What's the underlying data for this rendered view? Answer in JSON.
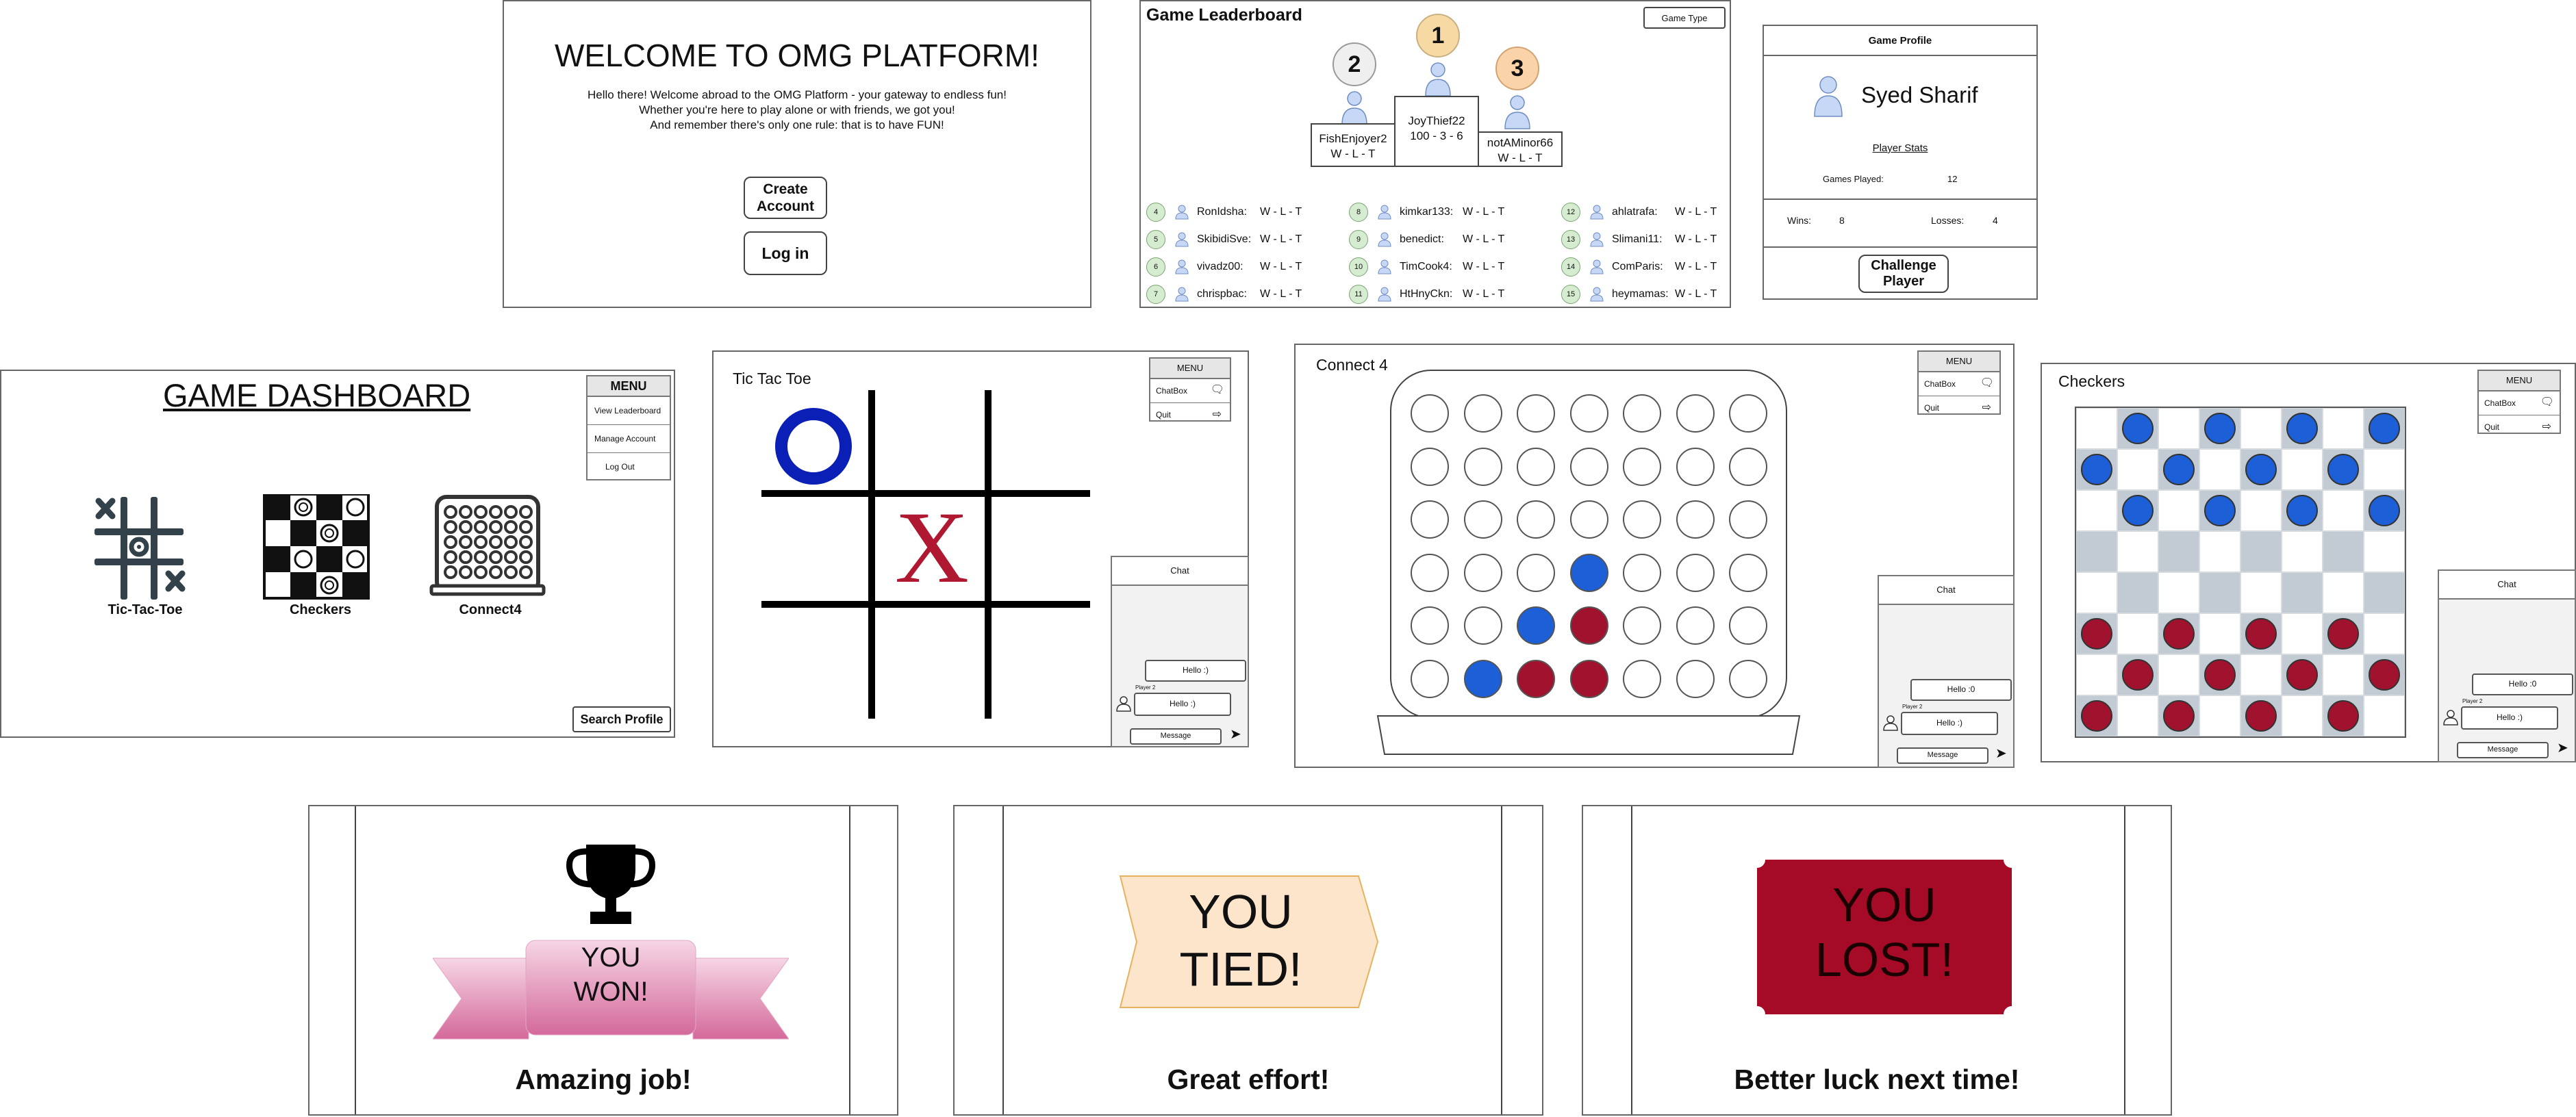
{
  "welcome": {
    "title": "WELCOME TO OMG PLATFORM!",
    "lines": [
      "Hello there! Welcome abroad to the OMG Platform - your gateway to endless fun!",
      "Whether you're here to play alone or with friends, we got you!",
      "And remember there's only one rule: that is to have FUN!"
    ],
    "create_account_line1": "Create",
    "create_account_line2": "Account",
    "login_label": "Log in"
  },
  "leaderboard": {
    "title": "Game Leaderboard",
    "game_type_label": "Game Type",
    "podium": [
      {
        "rank": "1",
        "name": "JoyThief22",
        "record": "100 - 3 - 6"
      },
      {
        "rank": "2",
        "name": "FishEnjoyer2",
        "record": "W - L - T"
      },
      {
        "rank": "3",
        "name": "notAMinor66",
        "record": "W - L - T"
      }
    ],
    "columns": [
      [
        {
          "rank": "4",
          "name": "RonIdsha:",
          "record": "W - L - T"
        },
        {
          "rank": "5",
          "name": "SkibidiSve:",
          "record": "W - L - T"
        },
        {
          "rank": "6",
          "name": "vivadz00:",
          "record": "W - L - T"
        },
        {
          "rank": "7",
          "name": "chrispbac:",
          "record": "W - L - T"
        }
      ],
      [
        {
          "rank": "8",
          "name": "kimkar133:",
          "record": "W - L - T"
        },
        {
          "rank": "9",
          "name": "benedict:",
          "record": "W - L - T"
        },
        {
          "rank": "10",
          "name": "TimCook4:",
          "record": "W - L - T"
        },
        {
          "rank": "11",
          "name": "HtHnyCkn:",
          "record": "W - L - T"
        }
      ],
      [
        {
          "rank": "12",
          "name": "ahlatrafa:",
          "record": "W - L - T"
        },
        {
          "rank": "13",
          "name": "Slimani11:",
          "record": "W - L - T"
        },
        {
          "rank": "14",
          "name": "ComParis:",
          "record": "W - L - T"
        },
        {
          "rank": "15",
          "name": "heymamas:",
          "record": "W - L - T"
        }
      ]
    ]
  },
  "profile": {
    "title": "Game Profile",
    "player_name": "Syed Sharif",
    "stats_label": "Player Stats",
    "games_played_label": "Games Played:",
    "games_played": "12",
    "wins_label": "Wins:",
    "wins": "8",
    "losses_label": "Losses:",
    "losses": "4",
    "challenge_line1": "Challenge",
    "challenge_line2": "Player"
  },
  "dashboard": {
    "title": "GAME DASHBOARD",
    "menu_title": "MENU",
    "menu_items": [
      "View Leaderboard",
      "Manage Account",
      "Log Out"
    ],
    "games": [
      "Tic-Tac-Toe",
      "Checkers",
      "Connect4"
    ],
    "search_profile_label": "Search Profile"
  },
  "game_menu": {
    "title": "MENU",
    "chatbox_label": "ChatBox",
    "quit_label": "Quit"
  },
  "chat": {
    "title": "Chat",
    "my_message": "Hello :)",
    "player2_label": "Player 2",
    "player2_message": "Hello :)",
    "input_placeholder": "Message"
  },
  "chat_alt": {
    "my_message": "Hello :0",
    "player2_message": "Hello :)"
  },
  "tictactoe": {
    "title": "Tic Tac Toe",
    "x_mark": "X"
  },
  "connect4": {
    "title": "Connect 4",
    "board": [
      [
        "",
        "",
        "",
        "",
        "",
        "",
        ""
      ],
      [
        "",
        "",
        "",
        "",
        "",
        "",
        ""
      ],
      [
        "",
        "",
        "",
        "",
        "",
        "",
        ""
      ],
      [
        "",
        "",
        "",
        "blue",
        "",
        "",
        ""
      ],
      [
        "",
        "",
        "blue",
        "red",
        "",
        "",
        ""
      ],
      [
        "",
        "blue",
        "red",
        "red",
        "",
        "",
        ""
      ]
    ]
  },
  "checkers": {
    "title": "Checkers",
    "rows": [
      [
        "",
        "blue",
        "",
        "blue",
        "",
        "blue",
        "",
        "blue"
      ],
      [
        "blue",
        "",
        "blue",
        "",
        "blue",
        "",
        "blue",
        ""
      ],
      [
        "",
        "blue",
        "",
        "blue",
        "",
        "blue",
        "",
        "blue"
      ],
      [
        "",
        "",
        "",
        "",
        "",
        "",
        "",
        ""
      ],
      [
        "",
        "",
        "",
        "",
        "",
        "",
        "",
        ""
      ],
      [
        "red",
        "",
        "red",
        "",
        "red",
        "",
        "red",
        ""
      ],
      [
        "",
        "red",
        "",
        "red",
        "",
        "red",
        "",
        "red"
      ],
      [
        "red",
        "",
        "red",
        "",
        "red",
        "",
        "red",
        ""
      ]
    ]
  },
  "results": {
    "won_line1": "YOU",
    "won_line2": "WON!",
    "won_caption": "Amazing job!",
    "tied_line1": "YOU",
    "tied_line2": "TIED!",
    "tied_caption": "Great effort!",
    "lost_line1": "YOU",
    "lost_line2": "LOST!",
    "lost_caption": "Better luck next time!"
  },
  "colors": {
    "blue_piece": "#1c5fd6",
    "red_piece": "#a1122e",
    "ttt_o": "#0a1fb5",
    "ttt_x": "#b01730",
    "gold": "#f7d9a4",
    "lost_red": "#a50a26",
    "tied_fill": "#fde5cc",
    "won_pink": "#e595bd"
  }
}
